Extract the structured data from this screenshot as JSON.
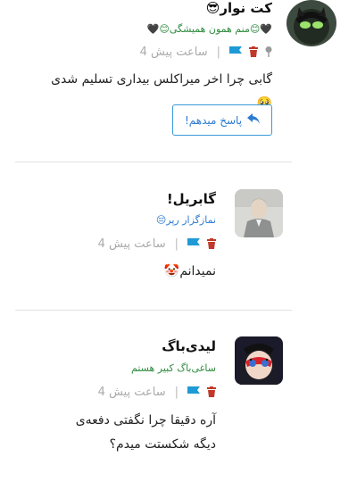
{
  "comments": [
    {
      "name": "کت نوار😎",
      "subtitle": "🖤😊منم همون همیشگی😊🖤",
      "time": "4 ساعت پیش",
      "separator": "|",
      "text": "گابی چرا اخر میراکلس بیداری تسلیم شدی🥺",
      "icons": [
        "pin-icon",
        "trash-icon",
        "flag-icon"
      ]
    },
    {
      "name": "گابریل!",
      "subtitle": "نمازگزار رپر😔",
      "time": "4 ساعت پیش",
      "separator": "|",
      "text": "نمیدانم🤡",
      "icons": [
        "trash-icon",
        "flag-icon"
      ]
    },
    {
      "name": "لیدی‌باگ",
      "subtitle": "ساغی‌باگ کبیر هستم",
      "time": "4 ساعت پیش",
      "separator": "|",
      "text": "آره دقیقا چرا نگفتی دفعه‌ی دیگه شکستت میدم؟",
      "icons": [
        "trash-icon",
        "flag-icon"
      ]
    }
  ],
  "reply_button": {
    "label": "پاسخ میدهم!",
    "icon": "reply-arrow-icon"
  },
  "colors": {
    "accent": "#2b7bd0",
    "flag": "#1e9ad6",
    "trash": "#c0392b",
    "time": "#aaaaaa",
    "divider": "#e2e2e2"
  }
}
